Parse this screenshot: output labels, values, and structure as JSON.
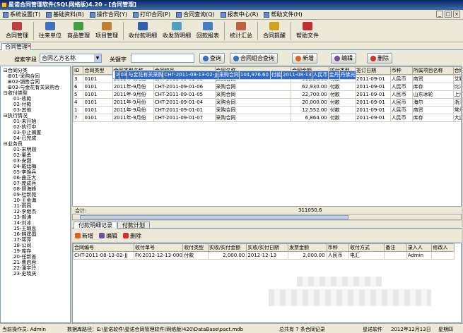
{
  "window": {
    "title": "星诺合同管理软件(SQL网络版)4.20 - [合同管理]"
  },
  "menu": [
    "系统设置(T)",
    "基础资料(B)",
    "操作合同(Y)",
    "打印合同(P)",
    "合同查询(Q)",
    "报表中心(R)",
    "帮助文件(H)"
  ],
  "toolbar": [
    {
      "label": "合同管理",
      "color": "#c04040"
    },
    {
      "label": "往来单位",
      "color": "#4070c0"
    },
    {
      "label": "商品管理",
      "color": "#40a040"
    },
    {
      "label": "项目管理",
      "color": "#c08030"
    },
    {
      "label": "收付款明细",
      "color": "#3060b0"
    },
    {
      "label": "收发货明细",
      "color": "#50a0c0"
    },
    {
      "label": "回款报表",
      "color": "#4080c0"
    },
    {
      "label": "统计汇总",
      "color": "#c06040"
    },
    {
      "label": "合同提醒",
      "color": "#d0a020"
    },
    {
      "label": "帮助文件",
      "color": "#c03030"
    }
  ],
  "doc_tab": "合同管理",
  "search": {
    "field_label": "搜索字段",
    "field_value": "合同乙方名称",
    "keyword_label": "关键字",
    "query": "查询",
    "combo_query": "合同组合查询",
    "add": "新增",
    "edit": "编辑",
    "delete": "删除"
  },
  "tree": [
    {
      "t": "合同分类",
      "d": 0,
      "m": "⊟"
    },
    {
      "t": "01-采购合同",
      "d": 1,
      "m": "⊞"
    },
    {
      "t": "02-销售合同",
      "d": 1,
      "m": "⊞"
    },
    {
      "t": "03-与金花有关采购合",
      "d": 1,
      "m": "⊞"
    },
    {
      "t": "收付类型",
      "d": 0,
      "m": "⊟"
    },
    {
      "t": "01-收款",
      "d": 1
    },
    {
      "t": "02-付款",
      "d": 1
    },
    {
      "t": "03-其他",
      "d": 1
    },
    {
      "t": "执行情况",
      "d": 0,
      "m": "⊟"
    },
    {
      "t": "01-未开始",
      "d": 1
    },
    {
      "t": "02-执行中",
      "d": 1
    },
    {
      "t": "03-中止搁置",
      "d": 1
    },
    {
      "t": "04-已完成",
      "d": 1
    },
    {
      "t": "业务员",
      "d": 0,
      "m": "⊟"
    },
    {
      "t": "01-宋明刚",
      "d": 1
    },
    {
      "t": "02-董勇",
      "d": 1
    },
    {
      "t": "03-安健",
      "d": 1
    },
    {
      "t": "04-戴廷梅",
      "d": 1
    },
    {
      "t": "05-李焕兵",
      "d": 1
    },
    {
      "t": "06-曲正大",
      "d": 1
    },
    {
      "t": "07-庞成兵",
      "d": 1
    },
    {
      "t": "08-顾海峰",
      "d": 1
    },
    {
      "t": "09-杜新苑",
      "d": 1
    },
    {
      "t": "10-王金海",
      "d": 1
    },
    {
      "t": "11-雨同",
      "d": 1
    },
    {
      "t": "12-李继杰",
      "d": 1
    },
    {
      "t": "13-郝涛",
      "d": 1
    },
    {
      "t": "14-刘冰",
      "d": 1
    },
    {
      "t": "15-王璐息",
      "d": 1
    },
    {
      "t": "16-韩建国",
      "d": 1
    },
    {
      "t": "17-蒋萍",
      "d": 1
    },
    {
      "t": "18-公司",
      "d": 1
    },
    {
      "t": "19-库存",
      "d": 1
    },
    {
      "t": "20-任新善",
      "d": 1
    },
    {
      "t": "21-曹启蓉",
      "d": 1
    },
    {
      "t": "22-潘宇玲",
      "d": 1
    },
    {
      "t": "23-史晓庆",
      "d": 1
    }
  ],
  "grid": {
    "headers": [
      "ID",
      "合同类型",
      "合同类型名称",
      "合同编号",
      "合同名称",
      "合同金额",
      "收付类型",
      "签订日期",
      "币种",
      "所属项目名称",
      "合同甲方"
    ],
    "rows": [
      [
        "2",
        "03",
        "与金花有关采购",
        "CHT-2011-08-13-02-JJ",
        "采购合同",
        "104,976.60",
        "付款",
        "2011-08-13",
        "人民币",
        "金丹",
        "丹佛光"
      ],
      [
        "3",
        "0101",
        "2011年-9月份",
        "CHT-2011-09-01-03",
        "采购合同",
        "81,026.00",
        "付款",
        "2011-09-01",
        "人民币",
        "商贸",
        "艾默生"
      ],
      [
        "6",
        "0101",
        "2011年-9月份",
        "CHT-2011-09-01-06",
        "采购合同",
        "62,930.00",
        "付款",
        "2011-09-01",
        "人民币",
        "库存",
        "比泽尔"
      ],
      [
        "5",
        "0101",
        "2011年-9月份",
        "CHT-2011-09-01-05",
        "采购合同",
        "22,700.00",
        "付款",
        "2011-09-01",
        "人民币",
        "山东冰轮",
        "上海特"
      ],
      [
        "4",
        "0101",
        "2011年-9月份",
        "CHT-2011-09-01-04",
        "采购合同",
        "20,000.00",
        "付款",
        "2011-09-01",
        "人民币",
        "海尔",
        "浙江利"
      ],
      [
        "1",
        "0101",
        "2011年-9月份",
        "CHT-2011-09-01-01",
        "采购合同",
        "12,552.00",
        "付款",
        "2011-09-01",
        "人民币",
        "商贸",
        "常州占"
      ],
      [
        "7",
        "0101",
        "2011年-9月份",
        "CHT-2011-09-01-07",
        "采购合同",
        "6,864.00",
        "付款",
        "2011-09-01",
        "人民币",
        "库存",
        "大连生"
      ]
    ],
    "sum_label": "合计:",
    "sum_value": "311050.6"
  },
  "lower": {
    "tabs": [
      "付款明细记录",
      "付款计划"
    ],
    "buttons": [
      "新增",
      "编辑",
      "删除"
    ],
    "headers": [
      "合同编号",
      "收付单号",
      "收付类型",
      "实收/实付金额",
      "实收/实付日期",
      "发票金额",
      "币种",
      "收付方式",
      "备注",
      "录入人",
      "修改人"
    ],
    "rows": [
      [
        "CHT-2011-08-13-02-JJ",
        "FK-2012-12-13-0001",
        "付款",
        "2,000.00",
        "2012-12-13",
        "2,000.00",
        "人民币",
        "电汇",
        "",
        "Admin",
        ""
      ]
    ]
  },
  "status": {
    "operator": "当前操作员: Admin",
    "dbpath": "数据库路径：E:\\星诺软件\\星诺合同管理软件(网络版)420\\DataBase\\pact.mdb",
    "total": "总共有 7 条合同记录",
    "brand": "星诺软件",
    "date": "2012年12月13日",
    "weekday": "星期四"
  }
}
